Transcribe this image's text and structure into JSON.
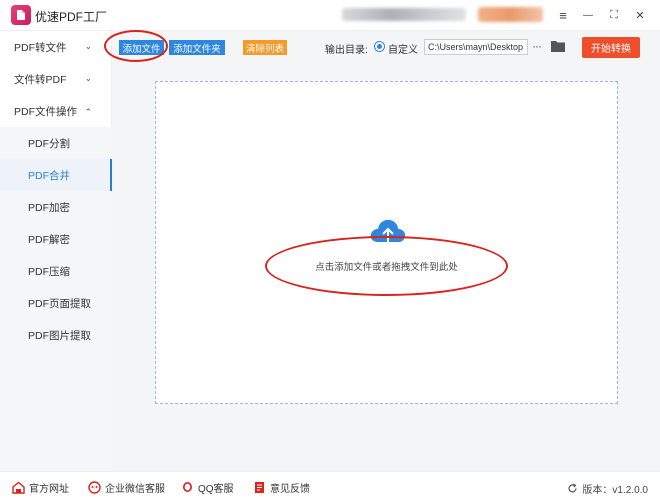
{
  "app": {
    "title": "优速PDF工厂"
  },
  "window_controls": {
    "menu": "≡",
    "minimize": "—",
    "maximize": "⛶",
    "close": "✕"
  },
  "sidebar": {
    "groups": [
      {
        "label": "PDF转文件",
        "chevron": "⌄"
      },
      {
        "label": "文件转PDF",
        "chevron": "⌄"
      },
      {
        "label": "PDF文件操作",
        "chevron": "⌃"
      }
    ],
    "items": [
      {
        "label": "PDF分割"
      },
      {
        "label": "PDF合并",
        "active": true
      },
      {
        "label": "PDF加密"
      },
      {
        "label": "PDF解密"
      },
      {
        "label": "PDF压缩"
      },
      {
        "label": "PDF页面提取"
      },
      {
        "label": "PDF图片提取"
      }
    ]
  },
  "toolbar": {
    "add_file": "添加文件",
    "add_folder": "添加文件夹",
    "clear_list": "清除列表",
    "output_label": "输出目录:",
    "custom_label": "自定义",
    "output_path": "C:\\Users\\mayn\\Desktop",
    "more": "···",
    "start": "开始转换"
  },
  "dropzone": {
    "hint": "点击添加文件或者拖拽文件到此处"
  },
  "footer": {
    "website": "官方网址",
    "wechat": "企业微信客服",
    "qq": "QQ客服",
    "feedback": "意见反馈",
    "version": "版本：v1.2.0.0"
  },
  "colors": {
    "accent": "#2e86de",
    "start": "#ee4e2b",
    "brand": "#e6407a",
    "annotation": "#d9231d"
  }
}
